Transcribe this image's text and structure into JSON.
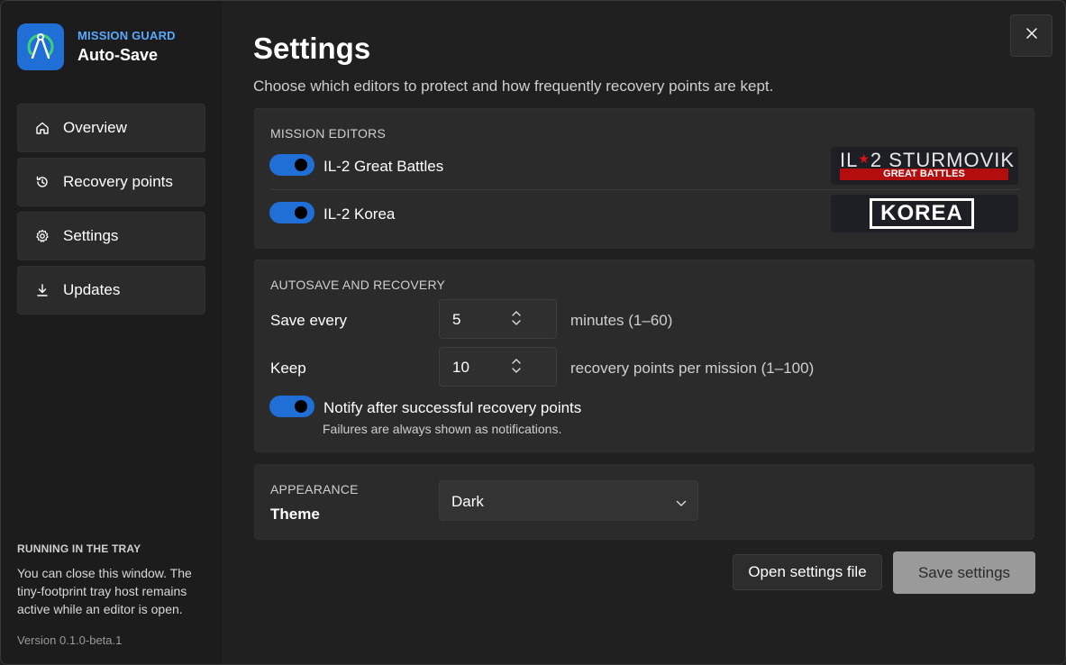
{
  "brand": {
    "top": "MISSION GUARD",
    "name": "Auto-Save"
  },
  "nav": {
    "items": [
      {
        "label": "Overview",
        "icon": "home-icon"
      },
      {
        "label": "Recovery points",
        "icon": "history-icon"
      },
      {
        "label": "Settings",
        "icon": "gear-icon"
      },
      {
        "label": "Updates",
        "icon": "download-icon"
      }
    ]
  },
  "tray": {
    "heading": "RUNNING IN THE TRAY",
    "body": "You can close this window. The tiny-footprint tray host remains active while an editor is open."
  },
  "version": "Version 0.1.0-beta.1",
  "header": {
    "title": "Settings",
    "subtitle": "Choose which editors to protect and how frequently recovery points are kept."
  },
  "editors": {
    "heading": "MISSION EDITORS",
    "items": [
      {
        "label": "IL-2 Great Battles",
        "enabled": true,
        "logo_main": "IL",
        "logo_num": "2",
        "logo_title": "STURMOVIK",
        "logo_sub": "GREAT BATTLES"
      },
      {
        "label": "IL-2 Korea",
        "enabled": true,
        "logo_text": "KOREA"
      }
    ]
  },
  "autosave": {
    "heading": "AUTOSAVE AND RECOVERY",
    "save_every_label": "Save every",
    "save_every_value": "5",
    "save_every_suffix": "minutes (1–60)",
    "keep_label": "Keep",
    "keep_value": "10",
    "keep_suffix": "recovery points per mission (1–100)",
    "notify_label": "Notify after successful recovery points",
    "notify_enabled": true,
    "notify_note": "Failures are always shown as notifications."
  },
  "appearance": {
    "heading": "APPEARANCE",
    "theme_label": "Theme",
    "theme_value": "Dark"
  },
  "actions": {
    "open_file": "Open settings file",
    "save": "Save settings"
  },
  "colors": {
    "accent": "#1f6fd6",
    "brand_text": "#5aa8ff",
    "background": "#202020",
    "card": "#2b2b2b"
  }
}
